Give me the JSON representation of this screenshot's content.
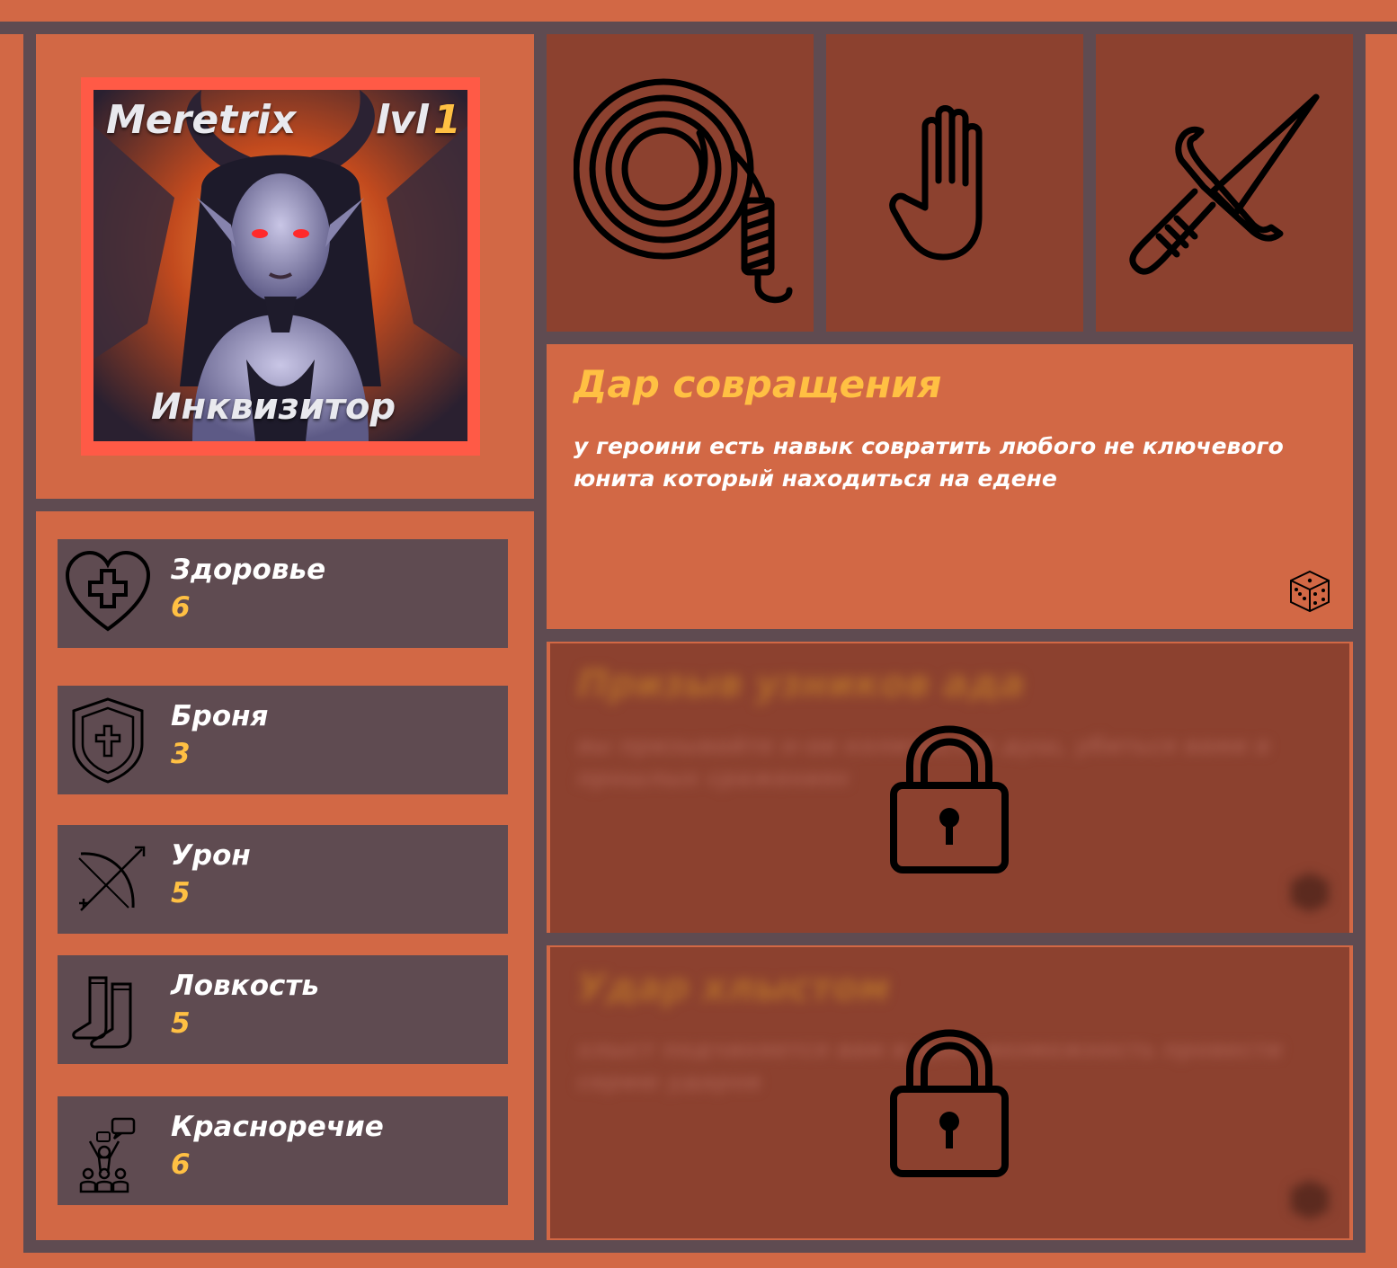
{
  "hero": {
    "name": "Meretrix",
    "level_prefix": "lvl",
    "level": "1",
    "class": "Инквизитор"
  },
  "stats": [
    {
      "label": "Здоровье",
      "value": "6",
      "icon": "heart-cross-icon"
    },
    {
      "label": "Броня",
      "value": "3",
      "icon": "shield-cross-icon"
    },
    {
      "label": "Урон",
      "value": "5",
      "icon": "bow-arrow-icon"
    },
    {
      "label": "Ловкость",
      "value": "5",
      "icon": "boots-icon"
    },
    {
      "label": "Красноречие",
      "value": "6",
      "icon": "crowd-speech-icon"
    }
  ],
  "equipment": [
    {
      "icon": "whip-icon"
    },
    {
      "icon": "hand-icon"
    },
    {
      "icon": "dagger-icon"
    }
  ],
  "skills": [
    {
      "title": "Дар совращения",
      "description": "у героини есть навык совратить любого не ключевого юнита который находиться на едене",
      "locked": false,
      "icon": "dice-icon"
    },
    {
      "title": "Призыв узников ада",
      "description": "вы призывайте н-ое количество душ, убиться вами в прошлых сражениях",
      "locked": true,
      "icon": "lock-icon"
    },
    {
      "title": "Удар хлыстом",
      "description": "хлыст подчиняется вам и дает возможность провести серию ударов",
      "locked": true,
      "icon": "lock-icon"
    }
  ],
  "colors": {
    "background": "#d26845",
    "frame": "#5f4b51",
    "panel_dark": "#8c412f",
    "accent_yellow": "#ffc043",
    "portrait_border": "#ff5a46"
  }
}
